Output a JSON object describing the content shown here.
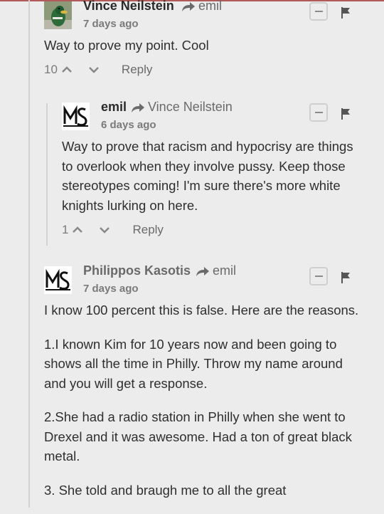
{
  "comments": [
    {
      "author": "Vince Neilstein",
      "reply_to": "emil",
      "time": "7 days ago",
      "paragraphs": [
        "Way to prove my point. Cool"
      ],
      "votes": "10",
      "reply_label": "Reply"
    },
    {
      "author": "emil",
      "reply_to": "Vince Neilstein",
      "time": "6 days ago",
      "paragraphs": [
        "Way to prove that racism and hypocrisy are things to overlook when they involve pussy. Keep those stereotypes coming! I'm sure there's more white knights lurking on here."
      ],
      "votes": "1",
      "reply_label": "Reply"
    },
    {
      "author": "Philippos Kasotis",
      "reply_to": "emil",
      "time": "7 days ago",
      "paragraphs": [
        "I know 100 percent this is false. Here are the reasons.",
        "1.I known Kim for 10 years now and been going to shows all the time in Philly. Throw my name around and you will get a response.",
        "2.She had a radio station in Philly when she went to Drexel and it was awesome. Had a ton of great black metal.",
        "3. She told and braugh me to all the great"
      ]
    }
  ],
  "colors": {
    "accent_line": "#b05a5a",
    "background": "#ececec"
  },
  "icons": [
    "avatar-duck",
    "avatar-ms-logo",
    "reply-arrow-icon",
    "collapse-icon",
    "flag-icon",
    "upvote-icon",
    "downvote-icon"
  ]
}
